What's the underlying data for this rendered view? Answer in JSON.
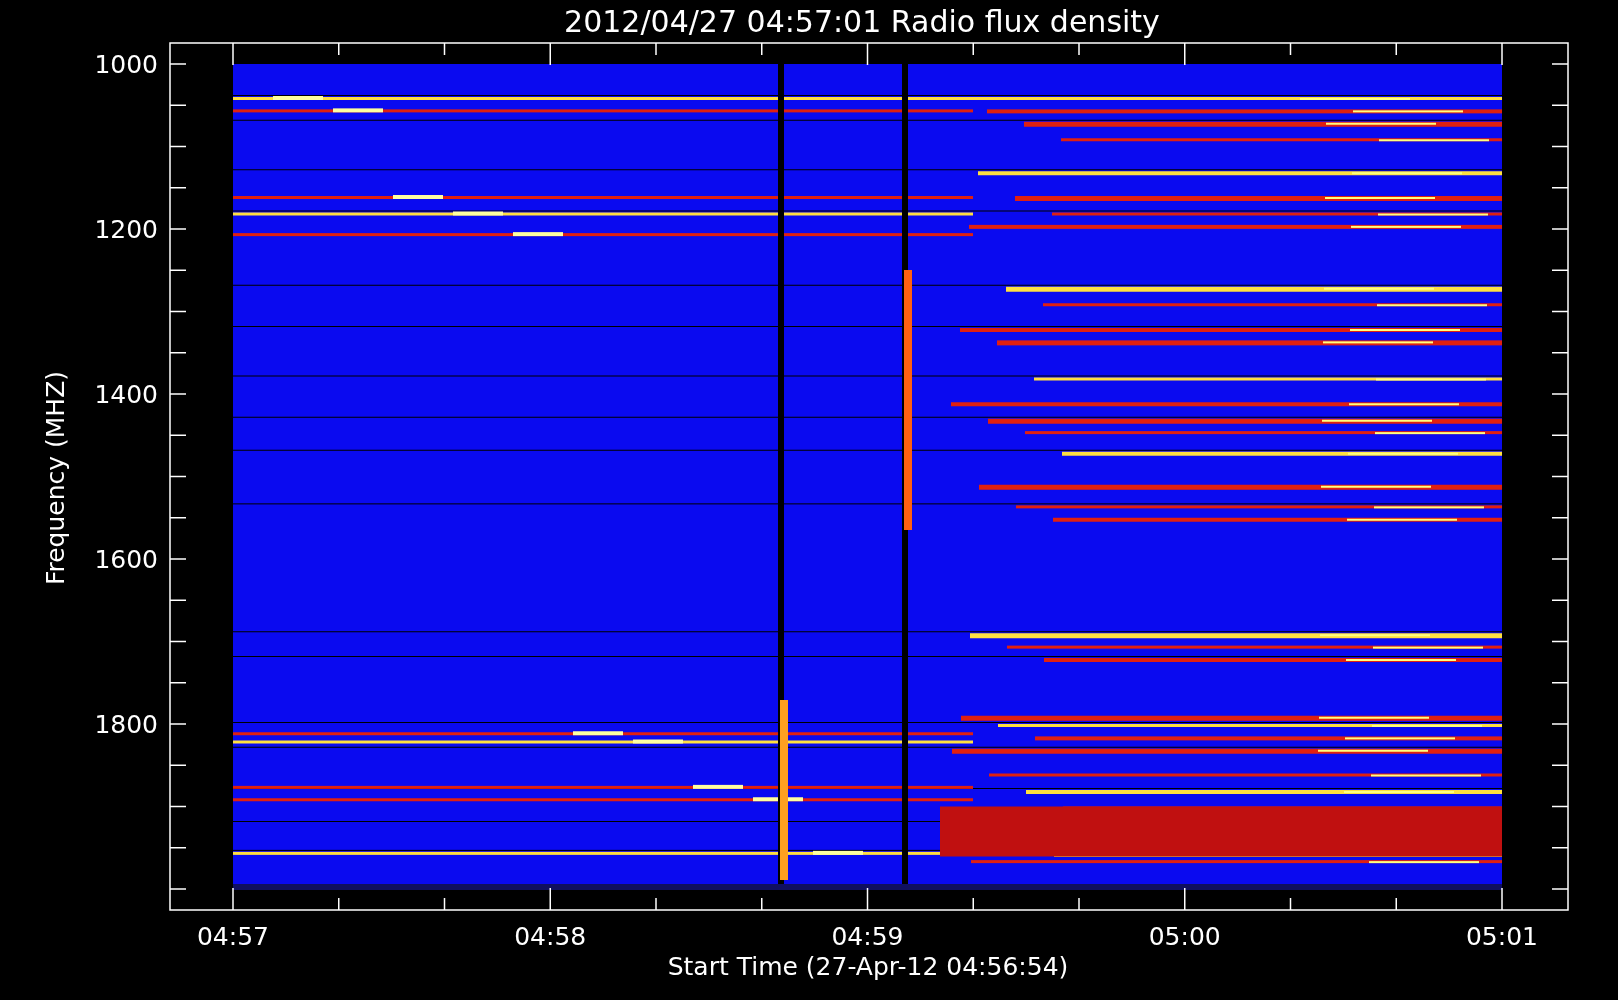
{
  "title": "2012/04/27 04:57:01 Radio flux density",
  "y_axis": {
    "label": "Frequency (MHZ)",
    "ticks": [
      "1000",
      "1200",
      "1400",
      "1600",
      "1800"
    ]
  },
  "x_axis": {
    "label": "Start Time (27-Apr-12 04:56:54)",
    "ticks": [
      "04:57",
      "04:58",
      "04:59",
      "05:00",
      "05:01"
    ]
  }
}
